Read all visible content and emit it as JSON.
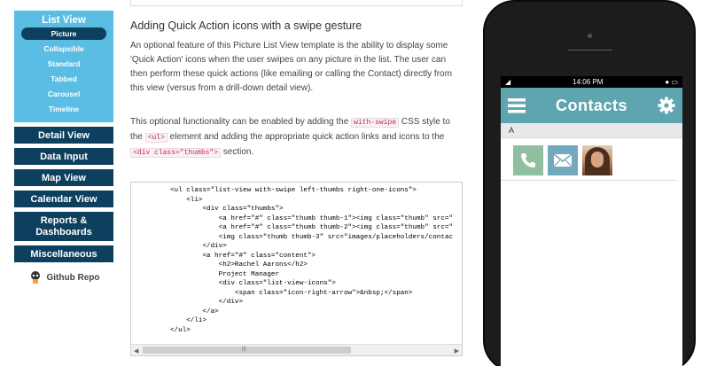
{
  "sidebar": {
    "group_title": "List View",
    "subitems": [
      {
        "label": "Picture",
        "active": true
      },
      {
        "label": "Collapsible"
      },
      {
        "label": "Standard"
      },
      {
        "label": "Tabbed"
      },
      {
        "label": "Carousel"
      },
      {
        "label": "Timeline"
      }
    ],
    "items": [
      {
        "label": "Detail View"
      },
      {
        "label": "Data Input"
      },
      {
        "label": "Map View"
      },
      {
        "label": "Calendar View"
      },
      {
        "label": "Reports & Dashboards"
      },
      {
        "label": "Miscellaneous"
      }
    ],
    "github_label": "Github Repo"
  },
  "content": {
    "heading": "Adding Quick Action icons with a swipe gesture",
    "para1": "An optional feature of this Picture List View template is the ability to display some 'Quick Action' icons when the user swipes on any picture in the list. The user can then perform these quick actions (like emailing or calling the Contact) directly from this view (versus from a drill-down detail view).",
    "para2_a": "This optional functionality can be enabled by adding the",
    "code_with_swipe": "with-swipe",
    "para2_b": "CSS style to the",
    "code_ul": "<ul>",
    "para2_c": "element and adding the appropriate quick action links and icons to the",
    "code_div_thumbs": "<div class=\"thumbs\">",
    "para2_d": "section."
  },
  "code_lines": [
    "<ul class=\"list-view with-swipe left-thumbs right-one-icons\">",
    "    <li>",
    "        <div class=\"thumbs\">",
    "            <a href=\"#\" class=\"thumb thumb-1\"><img class=\"thumb\" src=\"",
    "            <a href=\"#\" class=\"thumb thumb-2\"><img class=\"thumb\" src=\"",
    "            <img class=\"thumb thumb-3\" src=\"images/placeholders/contac",
    "        </div>",
    "        <a href=\"#\" class=\"content\">",
    "            <h2>Rachel Aarons</h2>",
    "            Project Manager",
    "            <div class=\"list-view-icons\">",
    "                <span class=\"icon-right-arrow\">&nbsp;</span>",
    "            </div>",
    "        </a>",
    "    </li>",
    "</ul>"
  ],
  "phone": {
    "time": "14:06 PM",
    "app_title": "Contacts",
    "divider": "A"
  },
  "colors": {
    "sidebar_group": "#5bbde4",
    "sidebar_item": "#0d3f5f",
    "appbar": "#5fa5b0",
    "qa_phone": "#8fbfa0",
    "qa_mail": "#72a9bd"
  }
}
